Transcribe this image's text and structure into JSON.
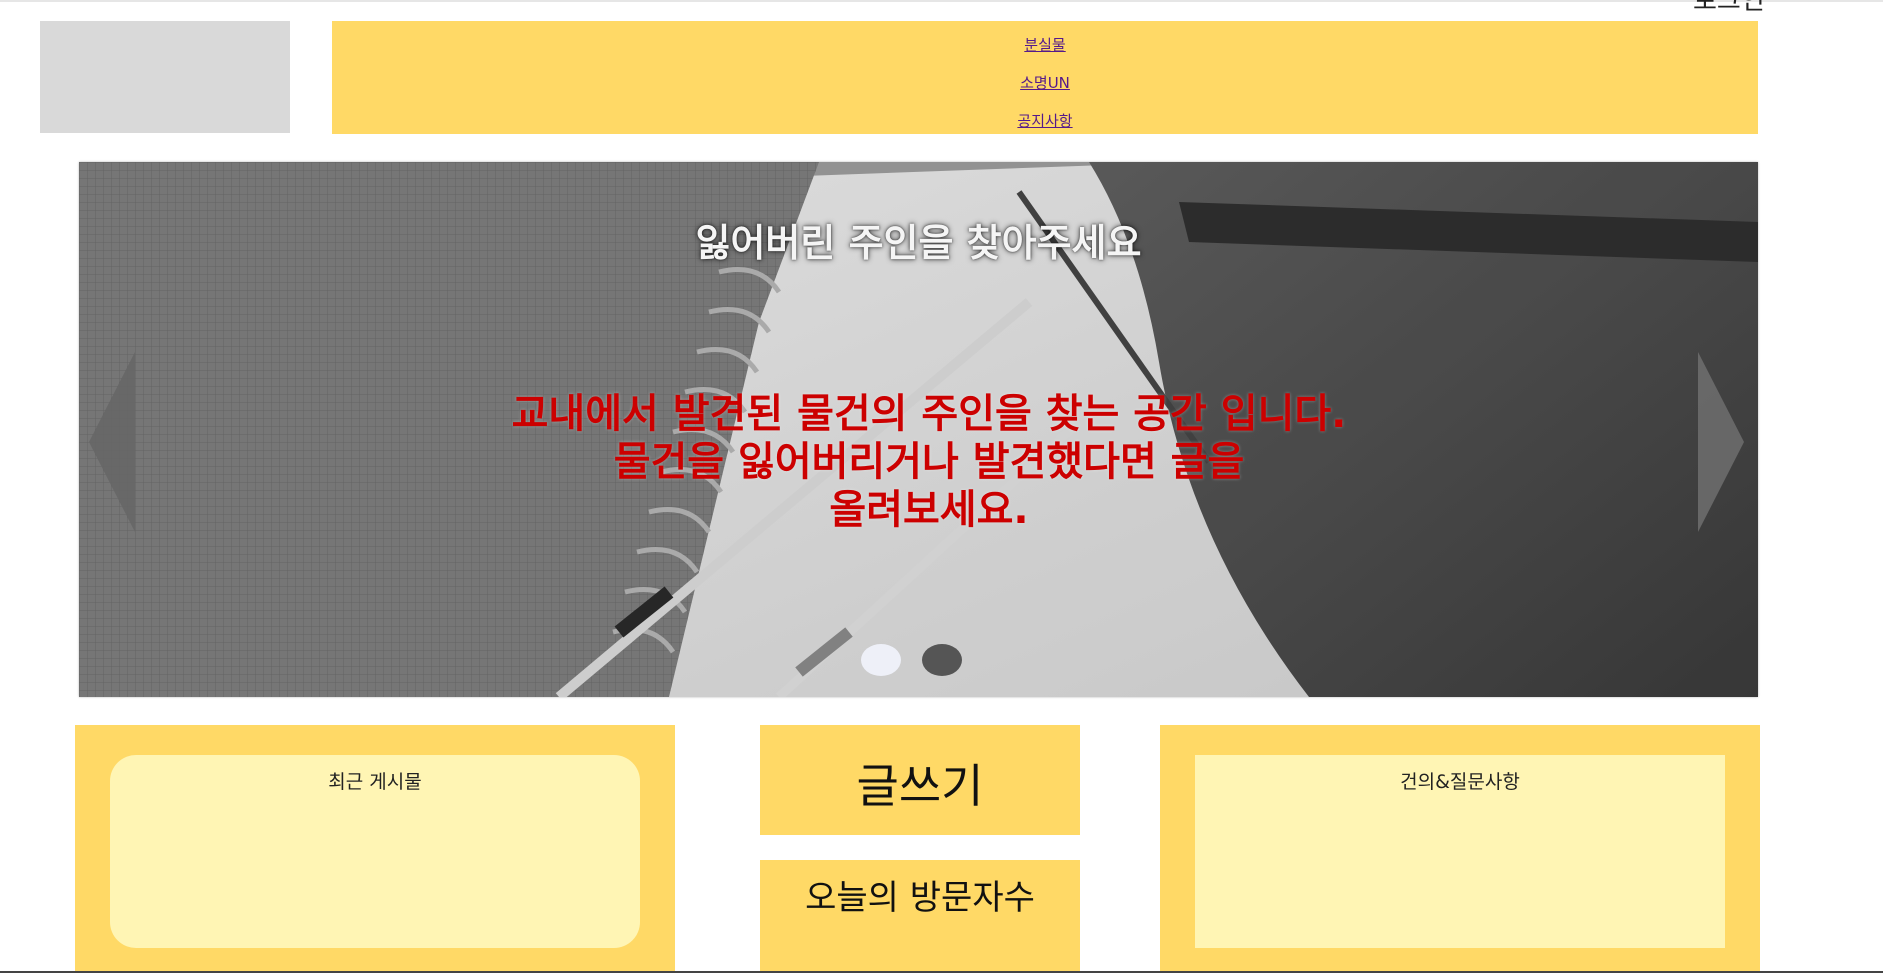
{
  "header": {
    "login_label": "로그인",
    "nav": [
      {
        "label": "분실물"
      },
      {
        "label": "소명UN"
      },
      {
        "label": "공지사항"
      }
    ]
  },
  "hero": {
    "title": "잃어버린 주인을 찾아주세요",
    "body_lines": [
      "교내에서 발견된 물건의 주인을 찾는 공간 입니다.",
      "물건을 잃어버리거나 발견했다면 글을",
      "올려보세요."
    ],
    "active_slide": 1,
    "slide_count": 2
  },
  "panels": {
    "recent_title": "최근 게시물",
    "write_label": "글쓰기",
    "visitors_label": "오늘의 방문자수",
    "suggest_title": "건의&질문사항"
  },
  "colors": {
    "panel": "#ffd966",
    "panel_inner": "#fff5b4",
    "logo_placeholder": "#d9d9d9",
    "hero_text": "#cc0000",
    "link": "#551a8b"
  },
  "icons": [
    "chevron-left-icon",
    "chevron-right-icon"
  ]
}
